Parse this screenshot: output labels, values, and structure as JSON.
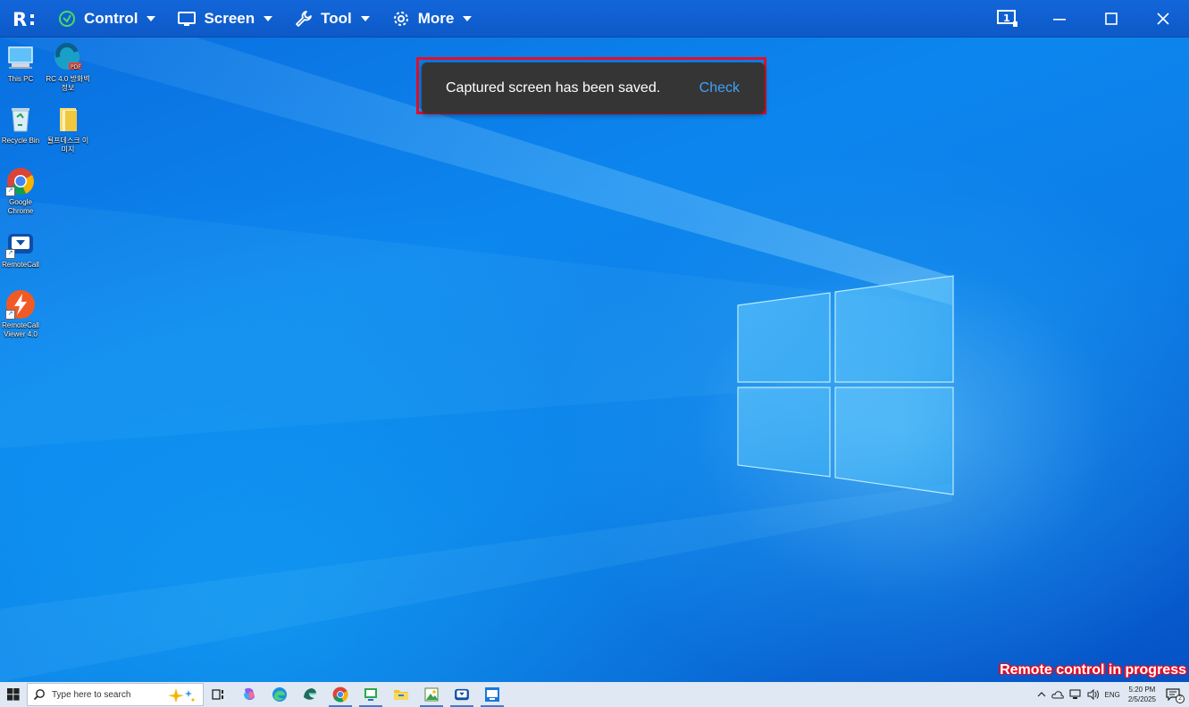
{
  "toolbar": {
    "logo_text": "R:",
    "menus": [
      {
        "label": "Control",
        "icon": "control-icon"
      },
      {
        "label": "Screen",
        "icon": "monitor-icon"
      },
      {
        "label": "Tool",
        "icon": "wrench-icon"
      },
      {
        "label": "More",
        "icon": "gear-icon"
      }
    ],
    "monitor_number": "1",
    "colors": {
      "bar": "#0f5fd1",
      "control_icon": "#4cd964"
    }
  },
  "desktop": {
    "icons": [
      {
        "label": "This PC",
        "icon": "this-pc-icon"
      },
      {
        "label": "RC 4.0 방화벽 정보",
        "icon": "pdf-file-icon",
        "badge": "PDF"
      },
      {
        "label": "Recycle Bin",
        "icon": "recycle-bin-icon"
      },
      {
        "label": "될프데스크 이미지",
        "icon": "folder-icon"
      },
      {
        "label": "Google Chrome",
        "icon": "chrome-icon"
      },
      {
        "label": "RemoteCall",
        "icon": "remotecall-icon"
      },
      {
        "label": "RemoteCall Viewer 4.0",
        "icon": "remotecall-viewer-icon"
      }
    ]
  },
  "toast": {
    "message": "Captured screen has been saved.",
    "action": "Check",
    "highlight_color": "#e0102a"
  },
  "status": {
    "text": "Remote control in progress"
  },
  "taskbar": {
    "search_placeholder": "Type here to search",
    "apps": [
      "copilot-icon",
      "task-view-icon",
      "edge-icon",
      "edge-dev-icon",
      "chrome-icon",
      "remote-support-icon",
      "file-explorer-icon",
      "image-viewer-icon",
      "remotecall-icon",
      "remotecall-viewer-icon"
    ],
    "tray": {
      "language": "ENG",
      "time": "5:20 PM",
      "date": "2/5/2025",
      "notification_count": "2"
    }
  }
}
